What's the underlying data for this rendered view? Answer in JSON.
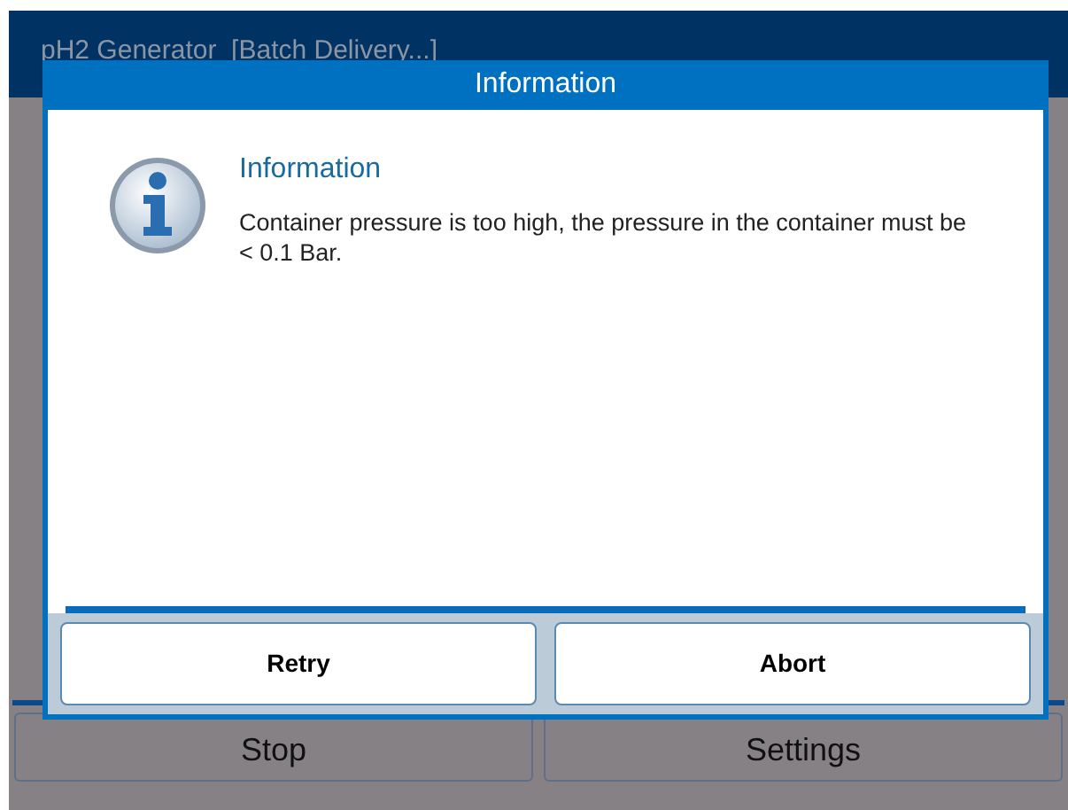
{
  "app": {
    "title": "pH2 Generator  [Batch Delivery...]"
  },
  "buttons": [
    {
      "label": "Stop"
    },
    {
      "label": "Settings"
    }
  ],
  "dialog": {
    "title": "Information",
    "heading": "Information",
    "message": "Container pressure is too high, the pressure in the container must be < 0.1 Bar.",
    "buttons": [
      {
        "label": "Retry"
      },
      {
        "label": "Abort"
      }
    ]
  }
}
